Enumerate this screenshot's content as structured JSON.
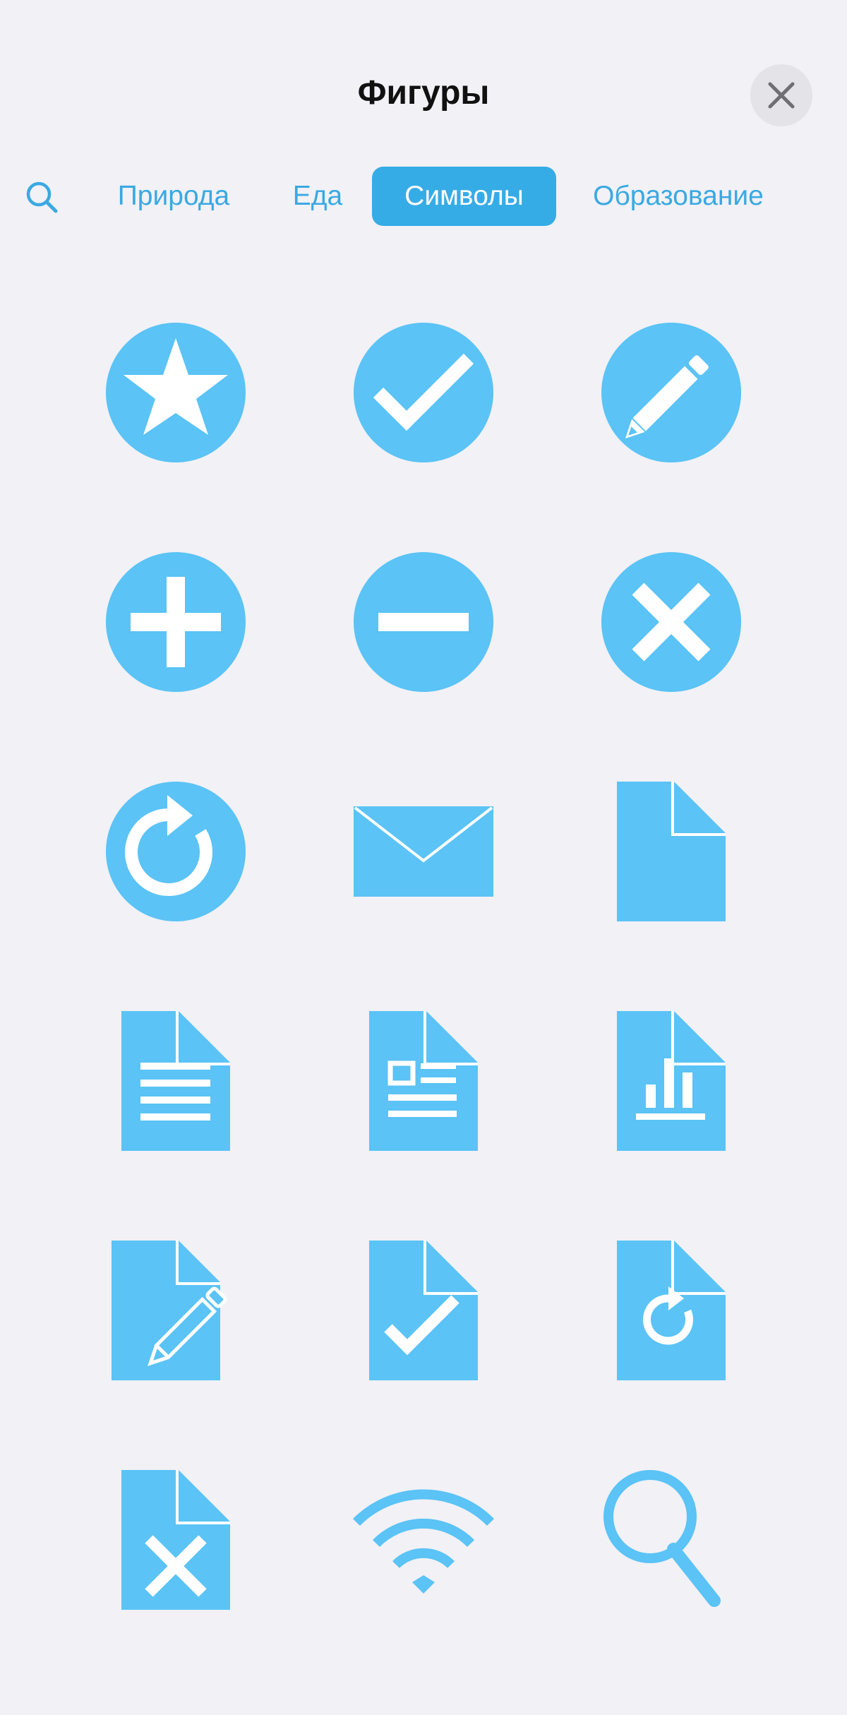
{
  "header": {
    "title": "Фигуры",
    "close_icon": "close-icon"
  },
  "tabs": [
    {
      "label": "Природа",
      "active": false
    },
    {
      "label": "Еда",
      "active": false
    },
    {
      "label": "Символы",
      "active": true
    },
    {
      "label": "Образование",
      "active": false
    }
  ],
  "search_icon": "search-icon",
  "colors": {
    "accent": "#36ace6",
    "shape_fill": "#5bc3f5",
    "background": "#f1f1f6"
  },
  "shapes": [
    "star-circle-icon",
    "checkmark-circle-icon",
    "pencil-circle-icon",
    "plus-circle-icon",
    "minus-circle-icon",
    "x-circle-icon",
    "refresh-circle-icon",
    "envelope-icon",
    "blank-document-icon",
    "text-document-icon",
    "layout-document-icon",
    "chart-document-icon",
    "edit-document-icon",
    "check-document-icon",
    "refresh-document-icon",
    "x-document-icon",
    "wifi-icon",
    "magnifier-icon"
  ]
}
